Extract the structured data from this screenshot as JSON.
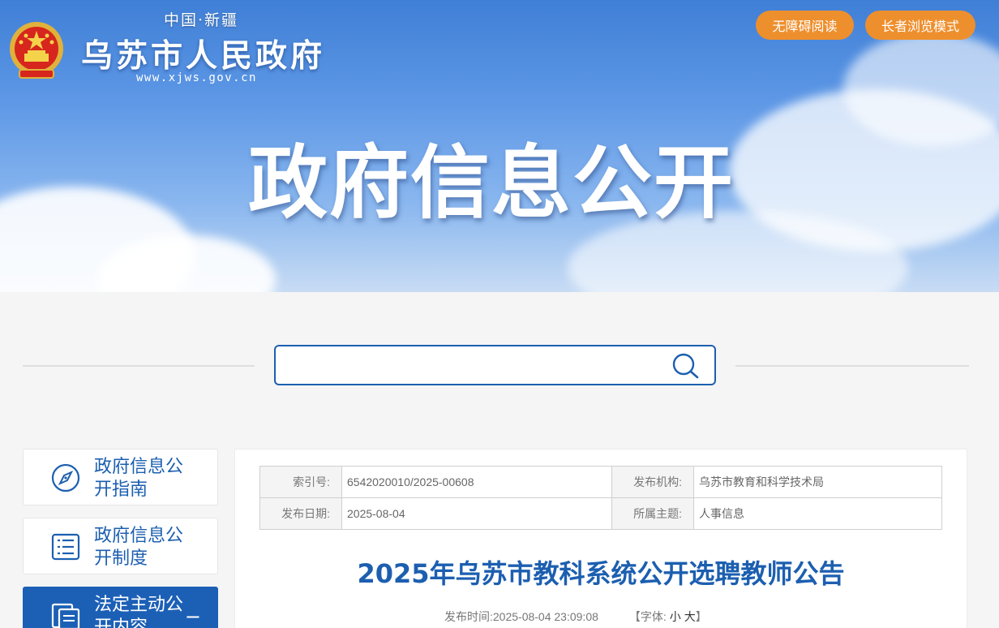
{
  "header": {
    "sub_title": "中国·新疆",
    "site_name": "乌苏市人民政府",
    "site_url": "www.xjws.gov.cn",
    "accessible_btn": "无障碍阅读",
    "elder_btn": "长者浏览模式",
    "hero_title": "政府信息公开"
  },
  "search": {
    "placeholder": ""
  },
  "sidebar": {
    "items": [
      {
        "label": "政府信息公开指南",
        "icon": "compass-icon",
        "active": false
      },
      {
        "label": "政府信息公开制度",
        "icon": "list-document-icon",
        "active": false
      },
      {
        "label": "法定主动公开内容",
        "icon": "documents-icon",
        "active": true,
        "toggle": "−"
      }
    ]
  },
  "article": {
    "meta": {
      "index_label": "索引号:",
      "index_value": "6542020010/2025-00608",
      "org_label": "发布机构:",
      "org_value": "乌苏市教育和科学技术局",
      "date_label": "发布日期:",
      "date_value": "2025-08-04",
      "topic_label": "所属主题:",
      "topic_value": "人事信息"
    },
    "title": "2025年乌苏市教科系统公开选聘教师公告",
    "publish_label": "发布时间:",
    "publish_time": "2025-08-04 23:09:08",
    "font_label_open": "【字体:",
    "font_small": "小",
    "font_large": "大",
    "font_label_close": "】"
  },
  "colors": {
    "brand_blue": "#1c5fb0",
    "accent_orange": "#ee8f2d"
  }
}
